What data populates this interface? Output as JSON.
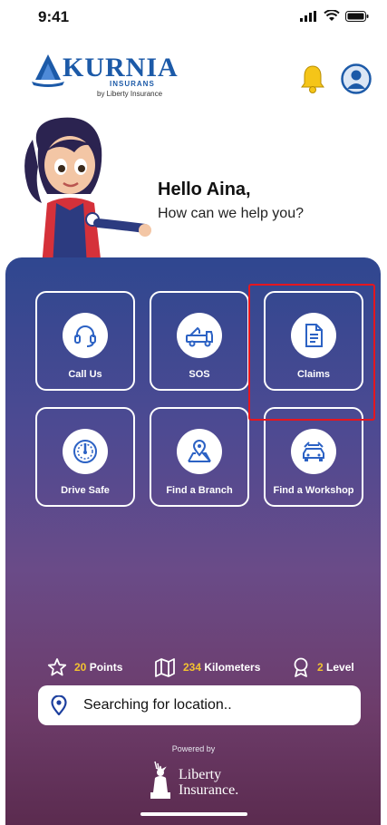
{
  "status_bar": {
    "time": "9:41"
  },
  "header": {
    "brand": "KURNIA",
    "brand_sub": "INSURANS",
    "brand_tagline": "by Liberty Insurance"
  },
  "greeting": {
    "title": "Hello Aina,",
    "subtitle": "How can we help you?"
  },
  "menu": {
    "tiles": [
      {
        "label": "Call Us",
        "icon": "headset-icon"
      },
      {
        "label": "SOS",
        "icon": "tow-truck-icon"
      },
      {
        "label": "Claims",
        "icon": "document-icon"
      },
      {
        "label": "Drive Safe",
        "icon": "speedometer-icon"
      },
      {
        "label": "Find a Branch",
        "icon": "map-pin-icon"
      },
      {
        "label": "Find a Workshop",
        "icon": "car-workshop-icon"
      }
    ]
  },
  "stats": {
    "points_value": "20",
    "points_label": "Points",
    "km_value": "234",
    "km_label": "Kilometers",
    "level_value": "2",
    "level_label": "Level"
  },
  "location": {
    "text": "Searching for location.."
  },
  "footer": {
    "powered_by": "Powered by",
    "brand_line1": "Liberty",
    "brand_line2": "Insurance."
  },
  "colors": {
    "accent_yellow": "#f2c230",
    "highlight_red": "#e5161f",
    "brand_blue": "#1c5aa8"
  }
}
